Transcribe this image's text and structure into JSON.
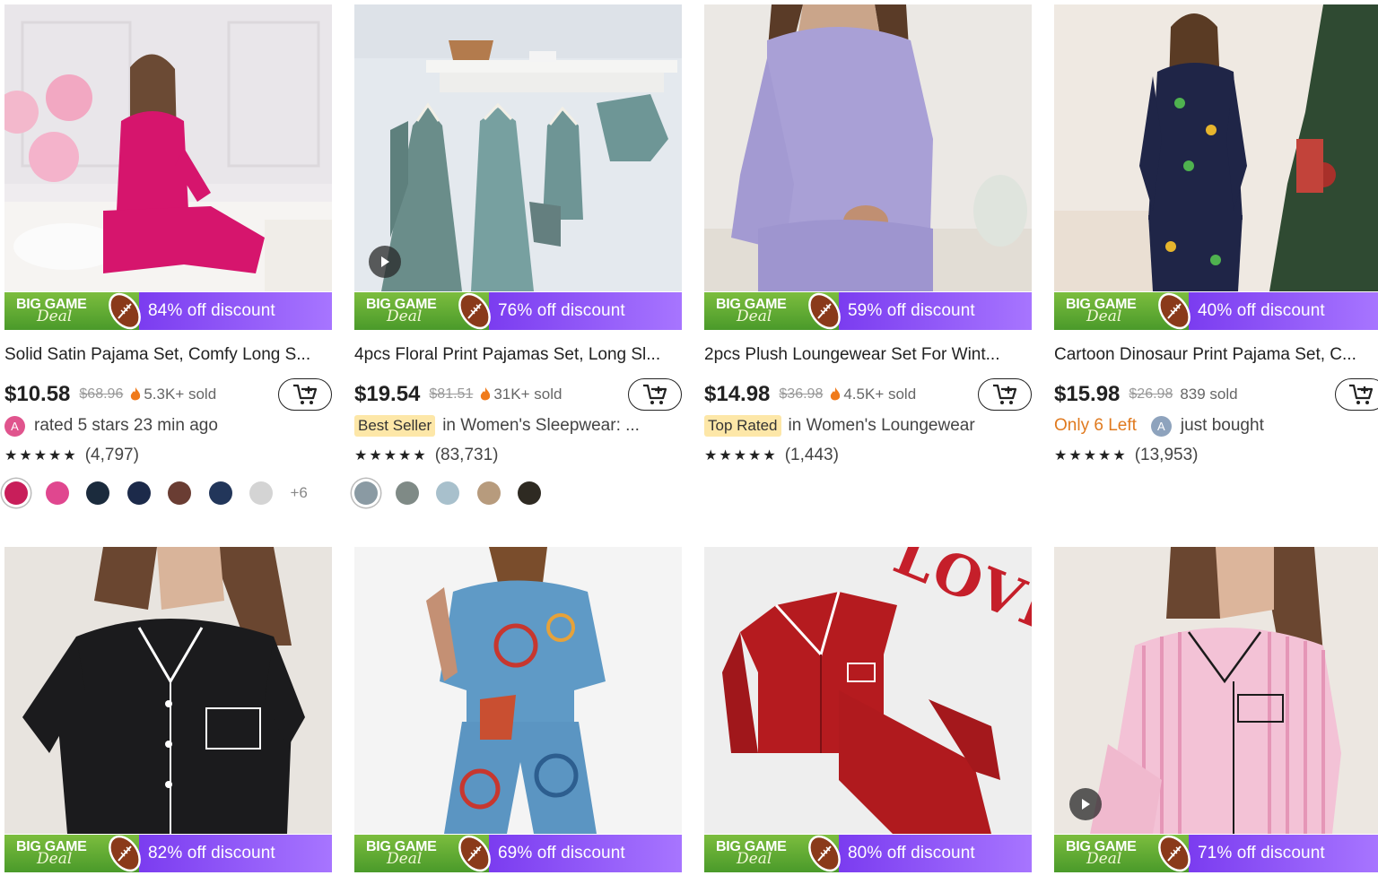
{
  "products_row1": [
    {
      "banner": {
        "big_game": "BIG GAME",
        "deal": "Deal",
        "discount": "84% off discount"
      },
      "title": "Solid Satin Pajama Set, Comfy Long S...",
      "price": "$10.58",
      "original_price": "$68.96",
      "sold": "5.3K+ sold",
      "social": {
        "avatar_letter": "A",
        "text": "rated 5 stars 23 min ago"
      },
      "stars": "★★★★★",
      "reviews": "(4,797)",
      "swatch_colors": [
        "#c81e5a",
        "#e0478f",
        "#1b2b3d",
        "#1c2a4a",
        "#6a3d33",
        "#22365a",
        "#d4d4d4"
      ],
      "more_colors": "+6"
    },
    {
      "banner": {
        "big_game": "BIG GAME",
        "deal": "Deal",
        "discount": "76% off discount"
      },
      "title": "4pcs Floral Print Pajamas Set, Long Sl...",
      "price": "$19.54",
      "original_price": "$81.51",
      "sold": "31K+ sold",
      "badge": "Best Seller",
      "category_text": "in Women's Sleepwear: ...",
      "stars": "★★★★★",
      "reviews": "(83,731)",
      "swatch_colors": [
        "#8a9aa3",
        "#7f8a86",
        "#a8c0cc",
        "#b79b7d",
        "#2e2a22"
      ]
    },
    {
      "banner": {
        "big_game": "BIG GAME",
        "deal": "Deal",
        "discount": "59% off discount"
      },
      "title": "2pcs Plush Loungewear Set For Wint...",
      "price": "$14.98",
      "original_price": "$36.98",
      "sold": "4.5K+ sold",
      "badge": "Top Rated",
      "category_text": "in Women's Loungewear",
      "stars": "★★★★★",
      "reviews": "(1,443)"
    },
    {
      "banner": {
        "big_game": "BIG GAME",
        "deal": "Deal",
        "discount": "40% off discount"
      },
      "title": "Cartoon Dinosaur Print Pajama Set, C...",
      "price": "$15.98",
      "original_price": "$26.98",
      "sold": "839 sold",
      "only_left": "Only 6 Left",
      "social": {
        "avatar_letter": "A",
        "text": "just bought"
      },
      "stars": "★★★★★",
      "reviews": "(13,953)"
    }
  ],
  "products_row2": [
    {
      "banner": {
        "big_game": "BIG GAME",
        "deal": "Deal",
        "discount": "82% off discount"
      }
    },
    {
      "banner": {
        "big_game": "BIG GAME",
        "deal": "Deal",
        "discount": "69% off discount"
      }
    },
    {
      "banner": {
        "big_game": "BIG GAME",
        "deal": "Deal",
        "discount": "80% off discount"
      }
    },
    {
      "banner": {
        "big_game": "BIG GAME",
        "deal": "Deal",
        "discount": "71% off discount"
      }
    }
  ],
  "image_text": {
    "love": "LOVE"
  },
  "colors": {
    "banner_green": "#5aa832",
    "banner_purple": "#8b4cf7",
    "only_left_orange": "#e07a1f",
    "flame_orange": "#f07a1a",
    "badge_yellow": "#fde7a8"
  },
  "icons": {
    "cart": "add-to-cart-icon",
    "flame": "flame-icon",
    "play": "play-icon",
    "football": "football-icon"
  }
}
